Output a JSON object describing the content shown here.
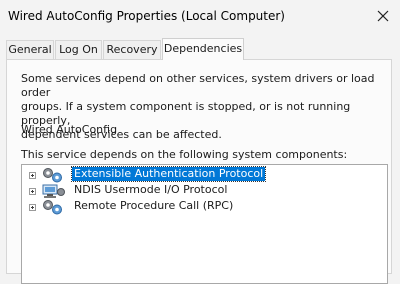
{
  "window": {
    "title": "Wired AutoConfig Properties (Local Computer)"
  },
  "tabs": [
    {
      "label": "General"
    },
    {
      "label": "Log On"
    },
    {
      "label": "Recovery"
    },
    {
      "label": "Dependencies",
      "active": true
    }
  ],
  "panel": {
    "description_lines": [
      "Some services depend on other services, system drivers or load order",
      "groups. If a system component is stopped, or is not running properly,",
      "dependent services can be affected."
    ],
    "service_name": "Wired AutoConfig",
    "depends_label": "This service depends on the following system components:",
    "tree_items": [
      {
        "label": "Extensible Authentication Protocol",
        "selected": true,
        "icon": "services-gear-icon"
      },
      {
        "label": "NDIS Usermode I/O Protocol",
        "selected": false,
        "icon": "driver-icon"
      },
      {
        "label": "Remote Procedure Call (RPC)",
        "selected": false,
        "icon": "services-gear-icon"
      }
    ]
  },
  "colors": {
    "selection": "#0078d7",
    "window_bg": "#f3f3f3",
    "panel_bg": "#fbfbfb"
  },
  "icons": {
    "close": "close-icon",
    "expander": "plus-expander-icon"
  }
}
